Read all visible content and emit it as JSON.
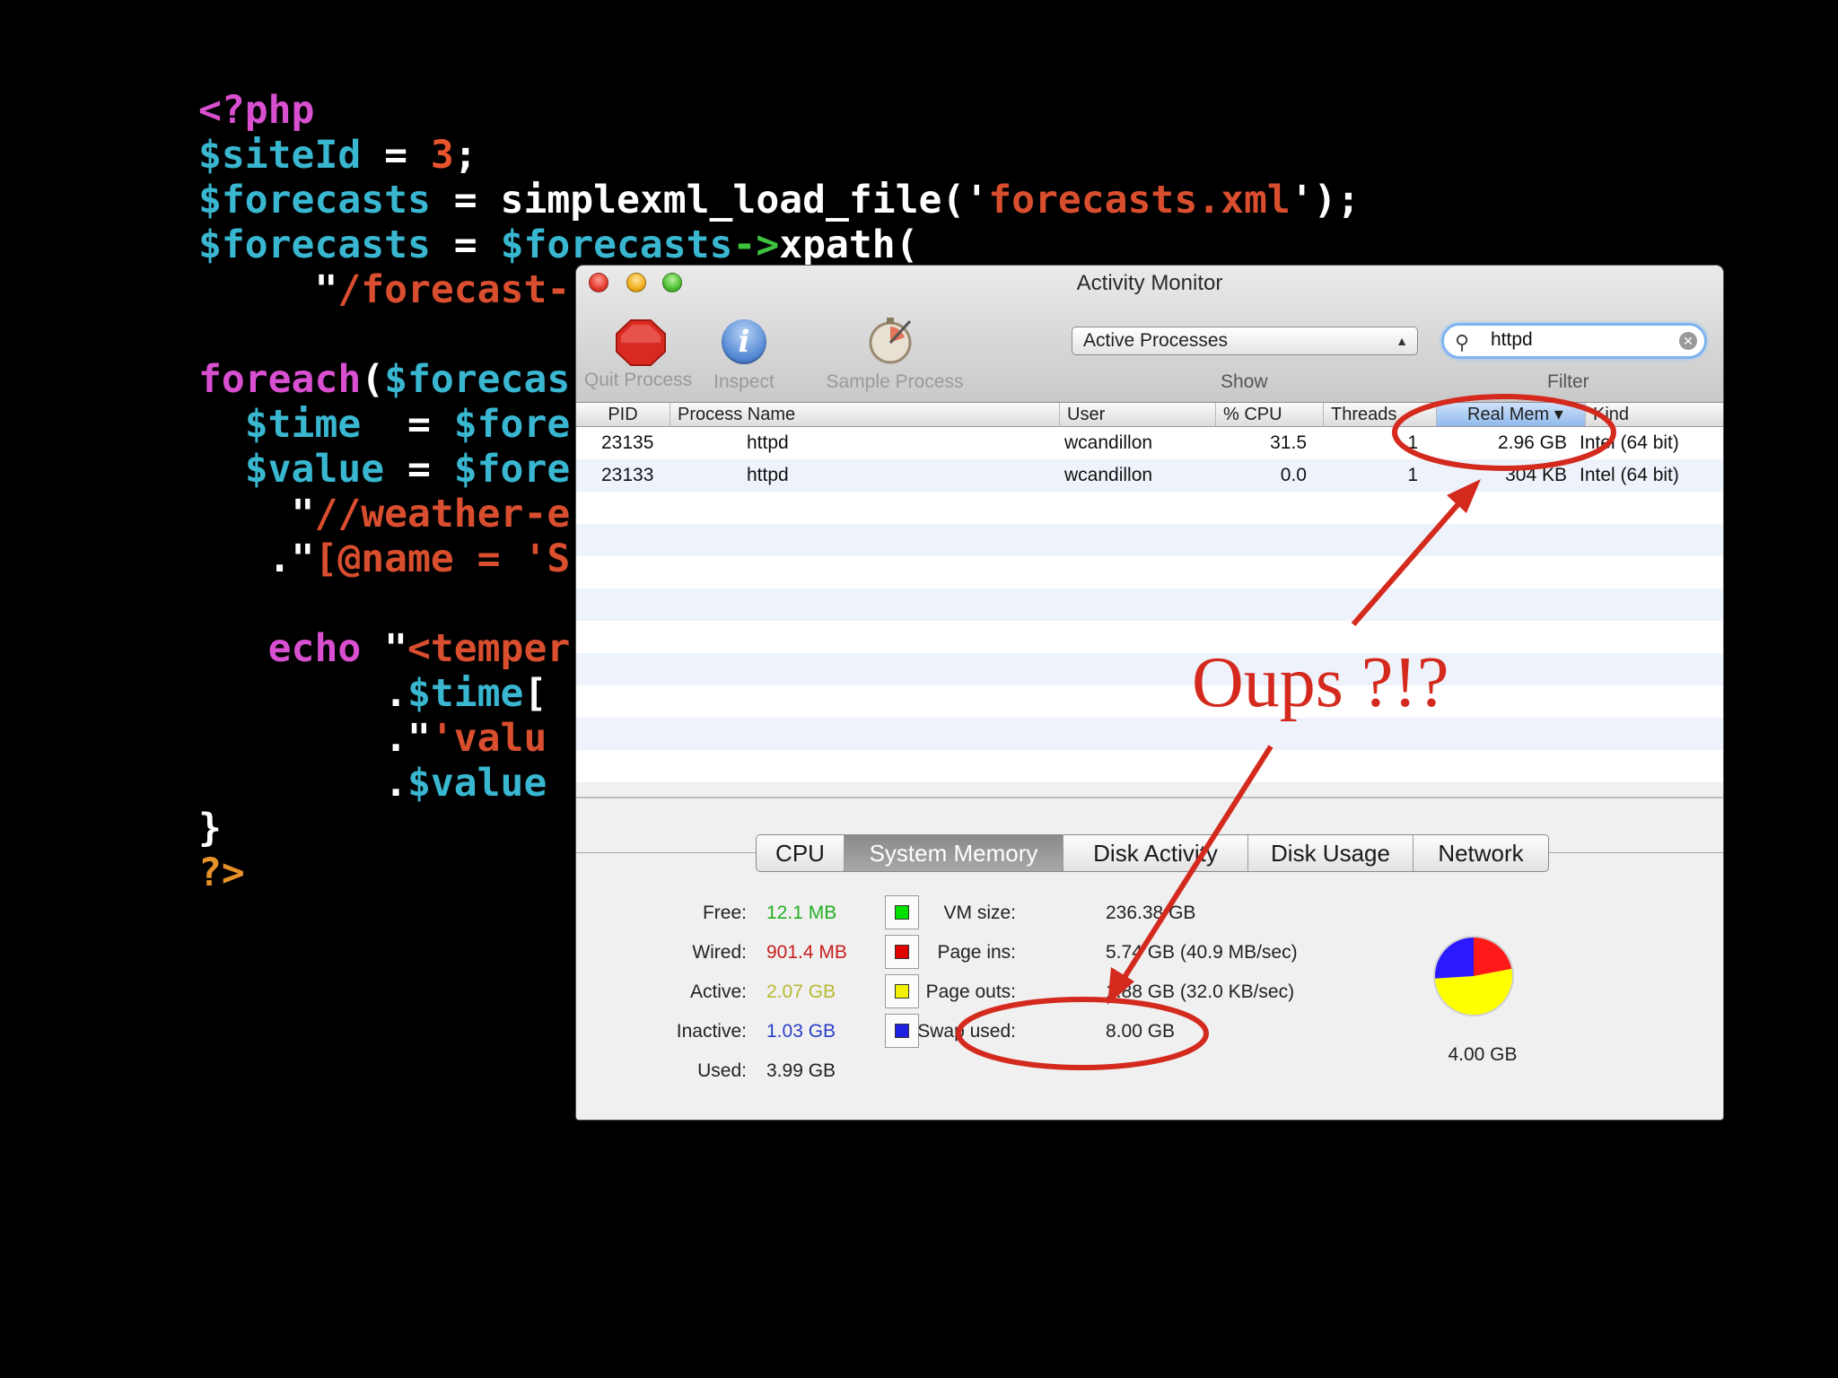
{
  "code": {
    "lines": [
      [
        {
          "t": "<?php",
          "c": "kw"
        }
      ],
      [
        {
          "t": "$siteId",
          "c": "var"
        },
        {
          "t": " = ",
          "c": "txt"
        },
        {
          "t": "3",
          "c": "num"
        },
        {
          "t": ";",
          "c": "txt"
        }
      ],
      [
        {
          "t": "$forecasts",
          "c": "var"
        },
        {
          "t": " = simplexml_load_file('",
          "c": "txt"
        },
        {
          "t": "forecasts.xml",
          "c": "str"
        },
        {
          "t": "');",
          "c": "txt"
        }
      ],
      [
        {
          "t": "$forecasts",
          "c": "var"
        },
        {
          "t": " = ",
          "c": "txt"
        },
        {
          "t": "$forecasts",
          "c": "var"
        },
        {
          "t": "->",
          "c": "op"
        },
        {
          "t": "xpath(",
          "c": "txt"
        }
      ],
      [
        {
          "t": "     \"",
          "c": "txt"
        },
        {
          "t": "/forecast-",
          "c": "str"
        }
      ],
      [],
      [
        {
          "t": "foreach",
          "c": "kw"
        },
        {
          "t": "(",
          "c": "txt"
        },
        {
          "t": "$forecas",
          "c": "var"
        }
      ],
      [
        {
          "t": "  $time",
          "c": "var"
        },
        {
          "t": "  = ",
          "c": "txt"
        },
        {
          "t": "$fore",
          "c": "var"
        }
      ],
      [
        {
          "t": "  $value",
          "c": "var"
        },
        {
          "t": " = ",
          "c": "txt"
        },
        {
          "t": "$fore",
          "c": "var"
        }
      ],
      [
        {
          "t": "    \"",
          "c": "txt"
        },
        {
          "t": "//weather-e",
          "c": "str"
        }
      ],
      [
        {
          "t": "   .\"",
          "c": "txt"
        },
        {
          "t": "[@name = 'S",
          "c": "str"
        }
      ],
      [],
      [
        {
          "t": "   echo",
          "c": "kw"
        },
        {
          "t": " \"",
          "c": "txt"
        },
        {
          "t": "<temper",
          "c": "str"
        }
      ],
      [
        {
          "t": "        .",
          "c": "txt"
        },
        {
          "t": "$time",
          "c": "var"
        },
        {
          "t": "[",
          "c": "txt"
        }
      ],
      [
        {
          "t": "        .\"",
          "c": "txt"
        },
        {
          "t": "'valu",
          "c": "str"
        }
      ],
      [
        {
          "t": "        .",
          "c": "txt"
        },
        {
          "t": "$value",
          "c": "var"
        }
      ],
      [
        {
          "t": "}",
          "c": "txt"
        }
      ],
      [
        {
          "t": "?>",
          "c": "end"
        }
      ]
    ]
  },
  "window": {
    "title": "Activity Monitor",
    "toolbar": {
      "quit_label": "Quit Process",
      "inspect_label": "Inspect",
      "sample_label": "Sample Process",
      "show_value": "Active Processes",
      "show_label": "Show",
      "filter_value": "httpd",
      "filter_label": "Filter"
    },
    "table": {
      "columns": [
        "PID",
        "Process Name",
        "User",
        "% CPU",
        "Threads",
        "Real Mem ▾",
        "Kind"
      ],
      "rows": [
        [
          "23135",
          "httpd",
          "wcandillon",
          "31.5",
          "1",
          "2.96 GB",
          "Intel (64 bit)"
        ],
        [
          "23133",
          "httpd",
          "wcandillon",
          "0.0",
          "1",
          "304 KB",
          "Intel (64 bit)"
        ]
      ]
    },
    "tabs": [
      "CPU",
      "System Memory",
      "Disk Activity",
      "Disk Usage",
      "Network"
    ],
    "selected_tab": "System Memory",
    "memory": [
      {
        "label": "Free:",
        "value": "12.1 MB",
        "color": "#22b022",
        "swatch": "#00e000"
      },
      {
        "label": "Wired:",
        "value": "901.4 MB",
        "color": "#c81e1e",
        "swatch": "#e00000"
      },
      {
        "label": "Active:",
        "value": "2.07 GB",
        "color": "#b8b830",
        "swatch": "#f0f000"
      },
      {
        "label": "Inactive:",
        "value": "1.03 GB",
        "color": "#2a3ec8",
        "swatch": "#2020e0"
      },
      {
        "label": "Used:",
        "value": "3.99 GB",
        "color": "#222222"
      }
    ],
    "vm": [
      {
        "label": "VM size:",
        "value": "236.38 GB"
      },
      {
        "label": "Page ins:",
        "value": "5.74 GB (40.9 MB/sec)"
      },
      {
        "label": "Page outs:",
        "value": "1.88 GB (32.0 KB/sec)"
      },
      {
        "label": "Swap used:",
        "value": "8.00 GB"
      }
    ],
    "pie": {
      "total_label": "4.00 GB",
      "slices": [
        {
          "name": "Wired",
          "color": "#ff1a1a",
          "fraction": 0.22
        },
        {
          "name": "Active",
          "color": "#ffff00",
          "fraction": 0.52
        },
        {
          "name": "Inactive",
          "color": "#2b1aff",
          "fraction": 0.26
        }
      ]
    }
  },
  "annotation": {
    "text": "Oups ?!?",
    "color": "#d42a1e"
  }
}
